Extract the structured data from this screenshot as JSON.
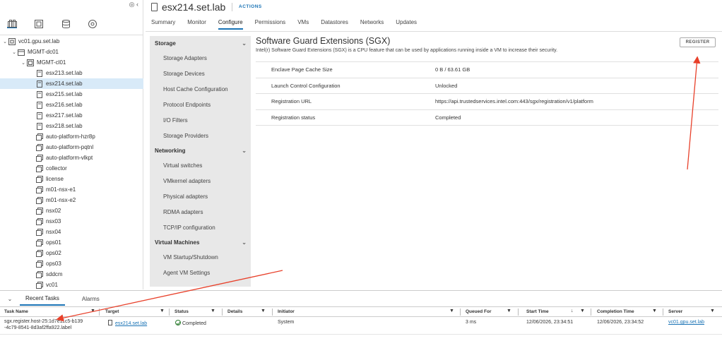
{
  "inventory": {
    "header_controls": "◎ ‹",
    "icons": [
      "hosts-clusters-icon",
      "vms-templates-icon",
      "storage-icon",
      "networking-icon"
    ],
    "tree": [
      {
        "label": "vc01.gpu.set.lab",
        "level": 0,
        "caret": "⌄",
        "icon": "vcenter-icon"
      },
      {
        "label": "MGMT-dc01",
        "level": 1,
        "caret": "⌄",
        "icon": "datacenter-icon"
      },
      {
        "label": "MGMT-cl01",
        "level": 2,
        "caret": "⌄",
        "icon": "cluster-icon"
      },
      {
        "label": "esx213.set.lab",
        "level": 3,
        "icon": "host-icon"
      },
      {
        "label": "esx214.set.lab",
        "level": 3,
        "icon": "host-icon",
        "selected": true
      },
      {
        "label": "esx215.set.lab",
        "level": 3,
        "icon": "host-icon"
      },
      {
        "label": "esx216.set.lab",
        "level": 3,
        "icon": "host-icon"
      },
      {
        "label": "esx217.set.lab",
        "level": 3,
        "icon": "host-icon"
      },
      {
        "label": "esx218.set.lab",
        "level": 3,
        "icon": "host-icon"
      },
      {
        "label": "auto-platform-hzr8p",
        "level": 3,
        "icon": "vm-icon"
      },
      {
        "label": "auto-platform-pqtnl",
        "level": 3,
        "icon": "vm-icon"
      },
      {
        "label": "auto-platform-vlkpt",
        "level": 3,
        "icon": "vm-icon"
      },
      {
        "label": "collector",
        "level": 3,
        "icon": "vm-icon"
      },
      {
        "label": "license",
        "level": 3,
        "icon": "vm-icon"
      },
      {
        "label": "m01-nsx-e1",
        "level": 3,
        "icon": "vm-icon"
      },
      {
        "label": "m01-nsx-e2",
        "level": 3,
        "icon": "vm-icon"
      },
      {
        "label": "nsx02",
        "level": 3,
        "icon": "vm-icon"
      },
      {
        "label": "nsx03",
        "level": 3,
        "icon": "vm-icon"
      },
      {
        "label": "nsx04",
        "level": 3,
        "icon": "vm-icon"
      },
      {
        "label": "ops01",
        "level": 3,
        "icon": "vm-icon"
      },
      {
        "label": "ops02",
        "level": 3,
        "icon": "vm-icon"
      },
      {
        "label": "ops03",
        "level": 3,
        "icon": "vm-icon"
      },
      {
        "label": "sddcm",
        "level": 3,
        "icon": "vm-icon"
      },
      {
        "label": "vc01",
        "level": 3,
        "icon": "vm-icon"
      }
    ]
  },
  "header": {
    "title": "esx214.set.lab",
    "actions_label": "ACTIONS",
    "tabs": [
      "Summary",
      "Monitor",
      "Configure",
      "Permissions",
      "VMs",
      "Datastores",
      "Networks",
      "Updates"
    ],
    "active_tab": "Configure"
  },
  "config_nav": [
    {
      "section": "Storage",
      "items": [
        "Storage Adapters",
        "Storage Devices",
        "Host Cache Configuration",
        "Protocol Endpoints",
        "I/O Filters",
        "Storage Providers"
      ]
    },
    {
      "section": "Networking",
      "items": [
        "Virtual switches",
        "VMkernel adapters",
        "Physical adapters",
        "RDMA adapters",
        "TCP/IP configuration"
      ]
    },
    {
      "section": "Virtual Machines",
      "items": [
        "VM Startup/Shutdown",
        "Agent VM Settings"
      ]
    }
  ],
  "content": {
    "title": "Software Guard Extensions (SGX)",
    "description": "Intel(r) Software Guard Extensions (SGX) is a CPU feature that can be used by applications running inside a VM to increase their security.",
    "register_label": "REGISTER",
    "properties": [
      {
        "key": "Enclave Page Cache Size",
        "value": "0 B / 63.61 GB"
      },
      {
        "key": "Launch Control Configuration",
        "value": "Unlocked"
      },
      {
        "key": "Registration URL",
        "value": "https://api.trustedservices.intel.com:443/sgx/registration/v1/platform"
      },
      {
        "key": "Registration status",
        "value": "Completed"
      }
    ]
  },
  "tasks": {
    "collapse_icon": "⌄",
    "tabs": [
      "Recent Tasks",
      "Alarms"
    ],
    "active_tab": "Recent Tasks",
    "columns": [
      "Task Name",
      "Target",
      "Status",
      "Details",
      "Initiator",
      "Queued For",
      "Start Time",
      "Completion Time",
      "Server"
    ],
    "rows": [
      {
        "task_name_line1": "sgx.register.host-25:1d7e11c5-b139",
        "task_name_line2": "-4c79-8541-8d3af2ffa922.label",
        "target": "esx214.set.lab",
        "status": "Completed",
        "details": "",
        "initiator": "System",
        "queued_for": "3 ms",
        "start_time": "12/06/2026, 23:34:51",
        "completion_time": "12/06/2026, 23:34:52",
        "server": "vc01.gpu.set.lab"
      }
    ],
    "sort_indicator": "↓"
  },
  "colors": {
    "accent": "#1a73b5",
    "arrow": "#e8402a",
    "selection": "#d8eaf8",
    "nav_bg": "#e8e8e8",
    "ok": "#2e7d32"
  }
}
